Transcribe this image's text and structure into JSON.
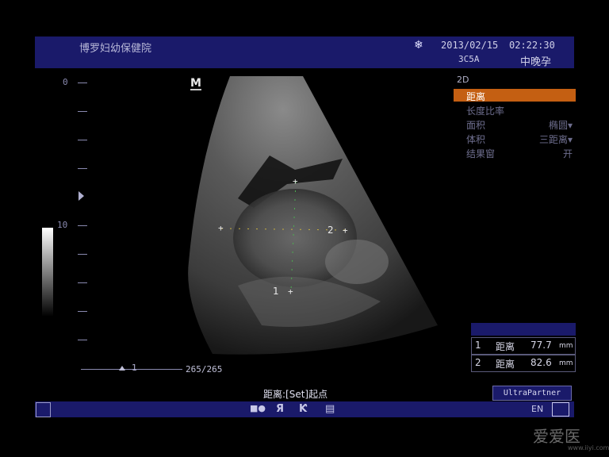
{
  "header": {
    "hospital": "博罗妇幼保健院",
    "freeze_icon": "snowflake-icon",
    "date": "2013/02/15",
    "time": "02:22:30",
    "probe": "3C5A",
    "preset": "中晚孕"
  },
  "depth_scale": {
    "top_label": "0",
    "mid_label": "10"
  },
  "image_marker": "M",
  "menu": {
    "mode": "2D",
    "items": [
      {
        "label": "距离",
        "value": ""
      },
      {
        "label": "长度比率",
        "value": ""
      },
      {
        "label": "面积",
        "value": "椭圆"
      },
      {
        "label": "体积",
        "value": "三距离"
      },
      {
        "label": "结果窗",
        "value": "开"
      }
    ]
  },
  "calipers": {
    "label_1": "1",
    "label_2": "2"
  },
  "results": [
    {
      "index": "1",
      "label": "距离",
      "value": "77.7",
      "unit": "mm"
    },
    {
      "index": "2",
      "label": "距离",
      "value": "82.6",
      "unit": "mm"
    }
  ],
  "cine": {
    "position_label": "1",
    "frames": "265/265"
  },
  "status_text": "距离:[Set]起点",
  "brand": "UltraPartner",
  "bottom_bar": {
    "lang": "EN"
  },
  "watermark": {
    "text": "爱爱医",
    "url": "www.iiyi.com"
  },
  "colors": {
    "header_bg": "#1a1a6a",
    "menu_selected": "#c45f12"
  }
}
